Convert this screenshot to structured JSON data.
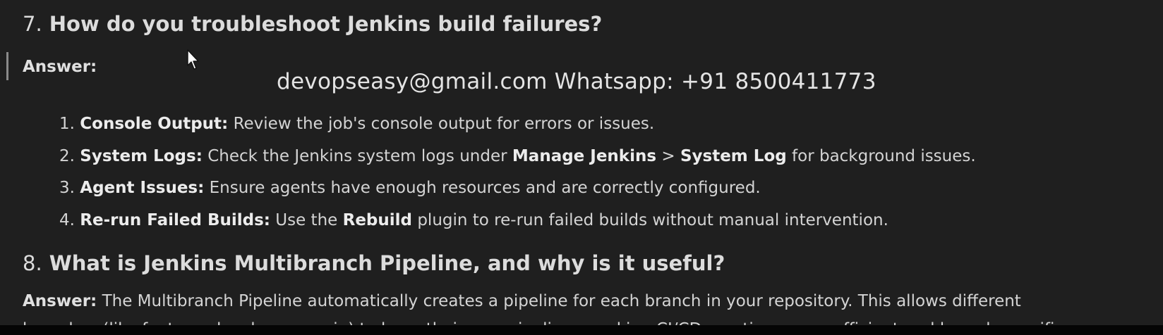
{
  "q7": {
    "number": "7.",
    "question": "How do you troubleshoot Jenkins build failures?",
    "answer_label": "Answer:",
    "steps": [
      {
        "num": "1.",
        "title": "Console Output:",
        "text": "Review the job's console output for errors or issues."
      },
      {
        "num": "2.",
        "title": "System Logs:",
        "text_a": "Check the Jenkins system logs under",
        "bold_a": "Manage Jenkins",
        "sep": ">",
        "bold_b": "System Log",
        "text_b": "for background issues."
      },
      {
        "num": "3.",
        "title": "Agent Issues:",
        "text": "Ensure agents have enough resources and are correctly configured."
      },
      {
        "num": "4.",
        "title": "Re-run Failed Builds:",
        "text_a": "Use the",
        "bold": "Rebuild",
        "text_b": "plugin to re-run failed builds without manual intervention."
      }
    ]
  },
  "q8": {
    "number": "8.",
    "question": "What is Jenkins Multibranch Pipeline, and why is it useful?",
    "answer_label": "Answer:",
    "answer_text": "The Multibranch Pipeline automatically creates a pipeline for each branch in your repository. This allows different",
    "answer_cut": "branches (like feature, develop, or main) to have their own pipelines, making CI/CD practices more efficient and branch-specific."
  },
  "watermark": "devopseasy@gmail.com Whatsapp: +91 8500411773",
  "icons": {
    "cursor": "mouse-pointer-icon"
  }
}
